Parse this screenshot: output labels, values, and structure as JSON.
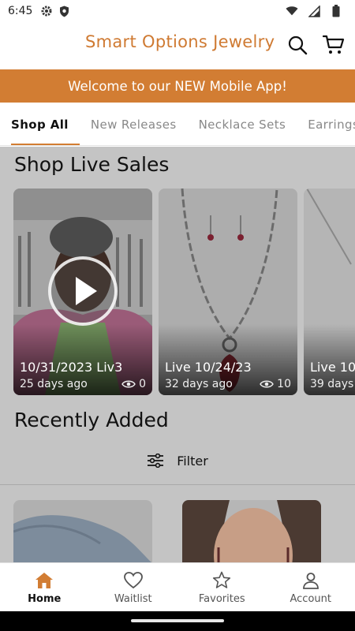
{
  "status_bar": {
    "time": "6:45"
  },
  "header": {
    "brand": "Smart Options Jewelry",
    "icons": [
      "search-icon",
      "cart-icon"
    ]
  },
  "banner": {
    "text": "Welcome to our NEW Mobile App!"
  },
  "tabs": [
    {
      "label": "Shop All",
      "active": true
    },
    {
      "label": "New Releases",
      "active": false
    },
    {
      "label": "Necklace Sets",
      "active": false
    },
    {
      "label": "Earrings",
      "active": false
    }
  ],
  "live_sales": {
    "heading": "Shop Live Sales",
    "cards": [
      {
        "title": "10/31/2023 Liv3",
        "ago": "25 days ago",
        "views": "0"
      },
      {
        "title": "Live 10/24/23",
        "ago": "32 days ago",
        "views": "10"
      },
      {
        "title": "Live 10",
        "ago": "39 days",
        "views": ""
      }
    ]
  },
  "recently_added": {
    "heading": "Recently Added",
    "filter_label": "Filter"
  },
  "bottom_nav": [
    {
      "label": "Home",
      "icon": "home-icon",
      "active": true
    },
    {
      "label": "Waitlist",
      "icon": "heart-icon",
      "active": false
    },
    {
      "label": "Favorites",
      "icon": "star-icon",
      "active": false
    },
    {
      "label": "Account",
      "icon": "account-icon",
      "active": false
    }
  ],
  "colors": {
    "accent": "#d27d33",
    "brand_text": "#cf7a32",
    "overlay": "#c4c4c4"
  }
}
